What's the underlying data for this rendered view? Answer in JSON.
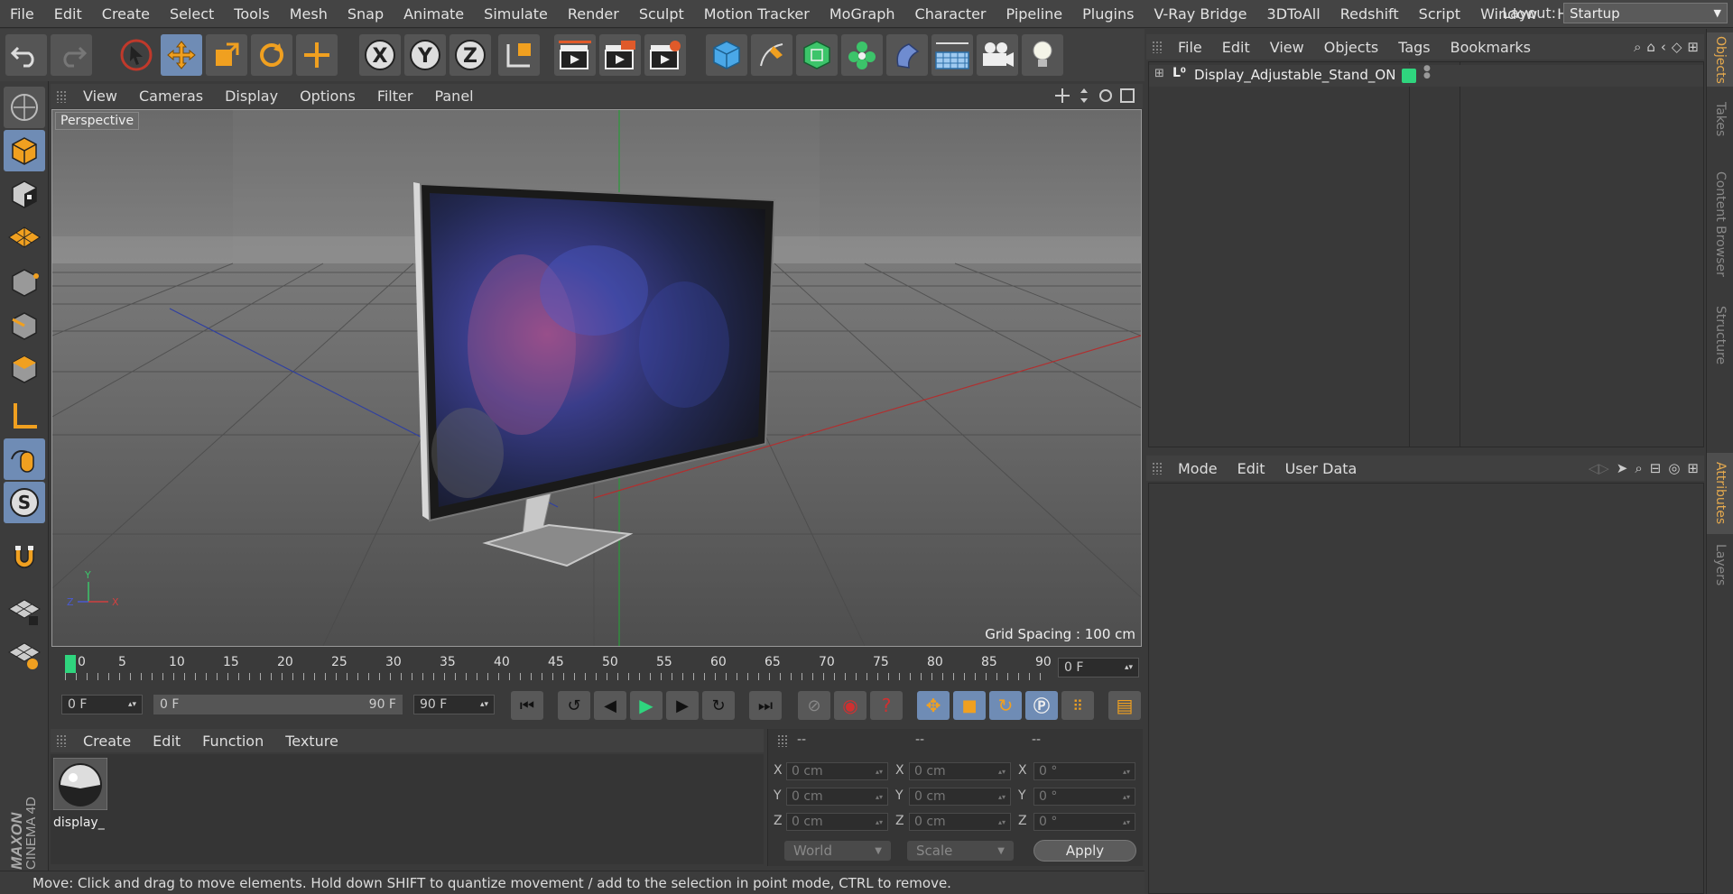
{
  "menubar": {
    "items": [
      "File",
      "Edit",
      "Create",
      "Select",
      "Tools",
      "Mesh",
      "Snap",
      "Animate",
      "Simulate",
      "Render",
      "Sculpt",
      "Motion Tracker",
      "MoGraph",
      "Character",
      "Pipeline",
      "Plugins",
      "V-Ray Bridge",
      "3DToAll",
      "Redshift",
      "Script",
      "Window",
      "Help"
    ],
    "layout_label": "Layout:",
    "layout_value": "Startup"
  },
  "toolbar": {
    "axis_x": "X",
    "axis_y": "Y",
    "axis_z": "Z"
  },
  "viewport": {
    "menu": [
      "View",
      "Cameras",
      "Display",
      "Options",
      "Filter",
      "Panel"
    ],
    "camera_label": "Perspective",
    "grid_spacing": "Grid Spacing : 100 cm",
    "axis_labels": {
      "x": "X",
      "y": "Y",
      "z": "Z"
    }
  },
  "timeline": {
    "ticks": [
      "0",
      "5",
      "10",
      "15",
      "20",
      "25",
      "30",
      "35",
      "40",
      "45",
      "50",
      "55",
      "60",
      "65",
      "70",
      "75",
      "80",
      "85",
      "90"
    ],
    "current_frame": "0 F"
  },
  "transport": {
    "start_frame": "0 F",
    "range_start": "0 F",
    "range_end": "90 F",
    "end_frame": "90 F"
  },
  "material_manager": {
    "menu": [
      "Create",
      "Edit",
      "Function",
      "Texture"
    ],
    "material_name": "display_"
  },
  "coordinates": {
    "headers": [
      "--",
      "--",
      "--"
    ],
    "rows": [
      {
        "pos_label": "X",
        "pos": "0 cm",
        "size_label": "X",
        "size": "0 cm",
        "rot_label": "X",
        "rot": "0 °"
      },
      {
        "pos_label": "Y",
        "pos": "0 cm",
        "size_label": "Y",
        "size": "0 cm",
        "rot_label": "Y",
        "rot": "0 °"
      },
      {
        "pos_label": "Z",
        "pos": "0 cm",
        "size_label": "Z",
        "size": "0 cm",
        "rot_label": "Z",
        "rot": "0 °"
      }
    ],
    "space_select": "World",
    "mode_select": "Scale",
    "apply_label": "Apply"
  },
  "object_manager": {
    "menu": [
      "File",
      "Edit",
      "View",
      "Objects",
      "Tags",
      "Bookmarks"
    ],
    "object_name": "Display_Adjustable_Stand_ON"
  },
  "attribute_manager": {
    "menu": [
      "Mode",
      "Edit",
      "User Data"
    ]
  },
  "side_tabs": {
    "top": [
      "Objects",
      "Takes",
      "Content Browser",
      "Structure"
    ],
    "bottom": [
      "Attributes",
      "Layers"
    ]
  },
  "branding": {
    "line1": "MAXON",
    "line2": "CINEMA 4D"
  },
  "status": "Move: Click and drag to move elements. Hold down SHIFT to quantize movement / add to the selection in point mode, CTRL to remove.",
  "colors": {
    "accent_blue": "#6f8cb5",
    "active_green": "#2fd57e",
    "tab_orange": "#e4a94e"
  }
}
